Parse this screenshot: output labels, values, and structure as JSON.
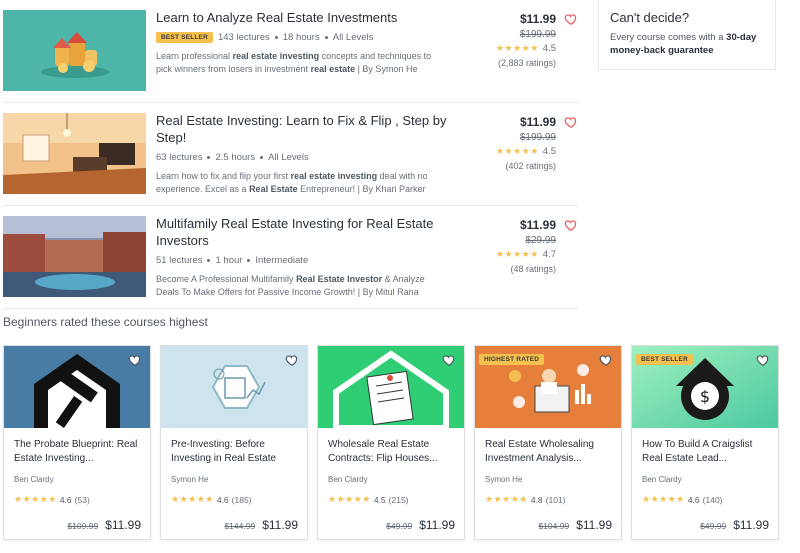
{
  "courses": [
    {
      "title": "Learn to Analyze Real Estate Investments",
      "badge": "Best Seller",
      "lectures": "143 lectures",
      "hours": "18 hours",
      "level": "All Levels",
      "desc_html": "Learn professional <b>real estate investing</b> concepts and techniques to pick winners from losers in investment <b>real estate</b> | By Symon He",
      "price": "$11.99",
      "old_price": "$199.99",
      "rating": "4.5",
      "stars": "★★★★★",
      "ratings_count": "(2,883 ratings)"
    },
    {
      "title": "Real Estate Investing: Learn to Fix & Flip , Step by Step!",
      "badge": "",
      "lectures": "63 lectures",
      "hours": "2.5 hours",
      "level": "All Levels",
      "desc_html": "Learn how to fix and flip your first <b>real estate investing</b> deal with no experience. Excel as a <b>Real Estate</b> Entrepreneur! | By Khari Parker",
      "price": "$11.99",
      "old_price": "$199.99",
      "rating": "4.5",
      "stars": "★★★★★",
      "ratings_count": "(402 ratings)"
    },
    {
      "title": "Multifamily Real Estate Investing for Real Estate Investors",
      "badge": "",
      "lectures": "51 lectures",
      "hours": "1 hour",
      "level": "Intermediate",
      "desc_html": "Become A Professional Multifamily <b>Real Estate Investor</b> &amp; Analyze Deals To Make Offers for Passive Income Growth! | By Mitul Rana",
      "price": "$11.99",
      "old_price": "$29.99",
      "rating": "4.7",
      "stars": "★★★★★",
      "ratings_count": "(48 ratings)"
    }
  ],
  "cant_decide": {
    "heading": "Can't decide?",
    "text_before": "Every course comes with a ",
    "text_bold": "30-day money-back guarantee"
  },
  "section_title": "Beginners rated these courses highest",
  "cards": [
    {
      "title": "The Probate Blueprint: Real Estate Investing...",
      "author": "Ben Clardy",
      "rating": "4.6",
      "ratings_count": "(53)",
      "old_price": "$109.99",
      "price": "$11.99",
      "badge": "",
      "stars": "★★★★★"
    },
    {
      "title": "Pre-Investing: Before Investing in Real Estate",
      "author": "Symon He",
      "rating": "4.6",
      "ratings_count": "(185)",
      "old_price": "$144.99",
      "price": "$11.99",
      "badge": "",
      "stars": "★★★★★"
    },
    {
      "title": "Wholesale Real Estate Contracts: Flip Houses...",
      "author": "Ben Clardy",
      "rating": "4.5",
      "ratings_count": "(215)",
      "old_price": "$49.99",
      "price": "$11.99",
      "badge": "",
      "stars": "★★★★★"
    },
    {
      "title": "Real Estate Wholesaling Investment Analysis...",
      "author": "Symon He",
      "rating": "4.8",
      "ratings_count": "(101)",
      "old_price": "$104.99",
      "price": "$11.99",
      "badge": "Highest Rated",
      "stars": "★★★★★"
    },
    {
      "title": "How To Build A Craigslist Real Estate Lead...",
      "author": "Ben Clardy",
      "rating": "4.6",
      "ratings_count": "(140)",
      "old_price": "$49.99",
      "price": "$11.99",
      "badge": "Best Seller",
      "stars": "★★★★★"
    }
  ],
  "colors": {
    "badge": "#f4c150",
    "star": "#f4c150",
    "heart_outline": "#ec5252",
    "text": "#29303b",
    "muted": "#686f7a"
  }
}
